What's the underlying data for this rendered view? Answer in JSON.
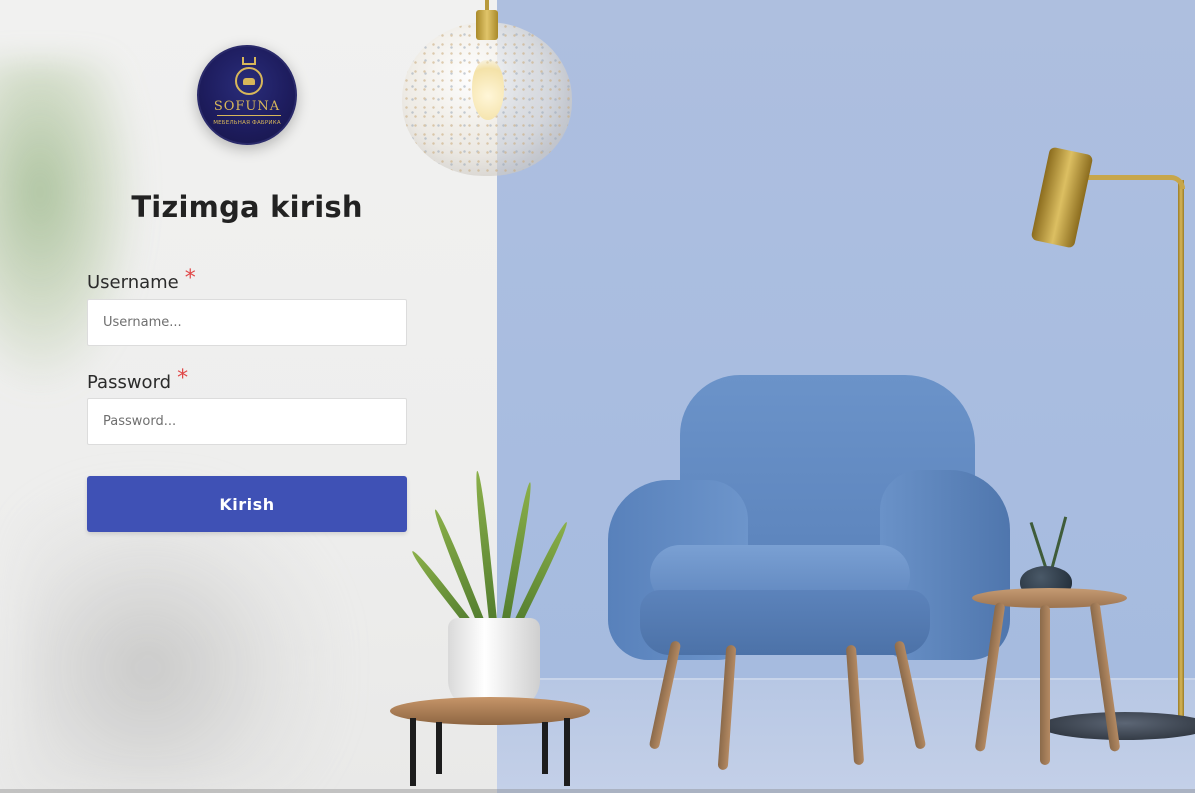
{
  "brand": {
    "logo_name": "SOFUNA",
    "logo_subtitle": "МЕБЕЛЬНАЯ ФАБРИКА",
    "accent_color": "#3f51b5",
    "logo_gold": "#d8b75a",
    "logo_navy": "#1e1d5f"
  },
  "login": {
    "title": "Tizimga kirish",
    "username": {
      "label": "Username",
      "required_mark": "*",
      "value": "",
      "placeholder": "Username..."
    },
    "password": {
      "label": "Password",
      "required_mark": "*",
      "value": "",
      "placeholder": "Password..."
    },
    "submit_label": "Kirish"
  },
  "icons": {
    "logo": "sofa-crown-emblem-icon"
  }
}
